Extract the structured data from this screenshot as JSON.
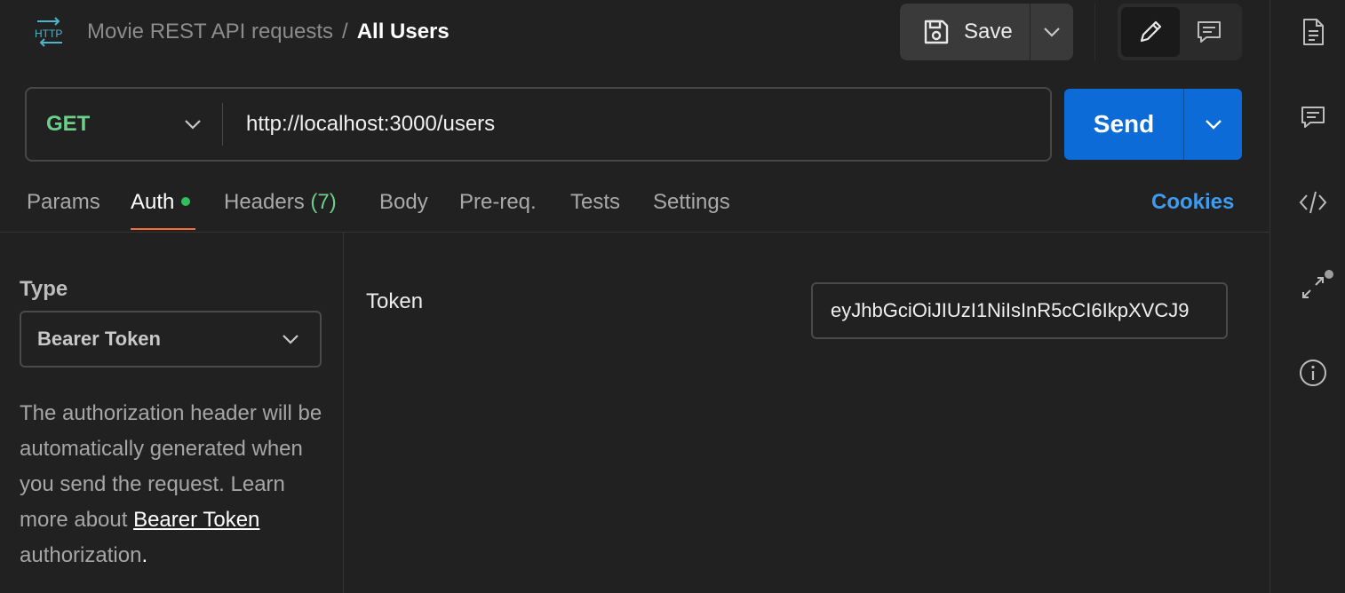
{
  "header": {
    "collection_name": "Movie REST API requests",
    "separator": "/",
    "request_name": "All Users",
    "http_badge": "HTTP",
    "save_label": "Save"
  },
  "request": {
    "method": "GET",
    "url": "http://localhost:3000/users",
    "send_label": "Send"
  },
  "tabs": [
    {
      "label": "Params"
    },
    {
      "label": "Auth",
      "active": true,
      "status_dot": true
    },
    {
      "label": "Headers",
      "count": "(7)"
    },
    {
      "label": "Body"
    },
    {
      "label": "Pre-req."
    },
    {
      "label": "Tests"
    },
    {
      "label": "Settings"
    }
  ],
  "cookies_label": "Cookies",
  "auth": {
    "type_label": "Type",
    "type_value": "Bearer Token",
    "description": "The authorization header will be automatically generated when you send the request. Learn more about ",
    "description_link": "Bearer Token",
    "description_tail": " authorization",
    "description_end": ".",
    "token_label": "Token",
    "token_value": "eyJhbGciOiJIUzI1NiIsInR5cCI6IkpXVCJ9"
  },
  "right_rail": {
    "icons": [
      "documentation-icon",
      "comments-icon",
      "code-icon",
      "related-collections-icon",
      "info-icon"
    ]
  },
  "colors": {
    "background": "#212121",
    "accent_send": "#0c6bd6",
    "method_get": "#6ccf8a",
    "active_tab_underline": "#ff6c37",
    "cookies_link": "#3e9cf0",
    "status_dot": "#2ec05a"
  }
}
